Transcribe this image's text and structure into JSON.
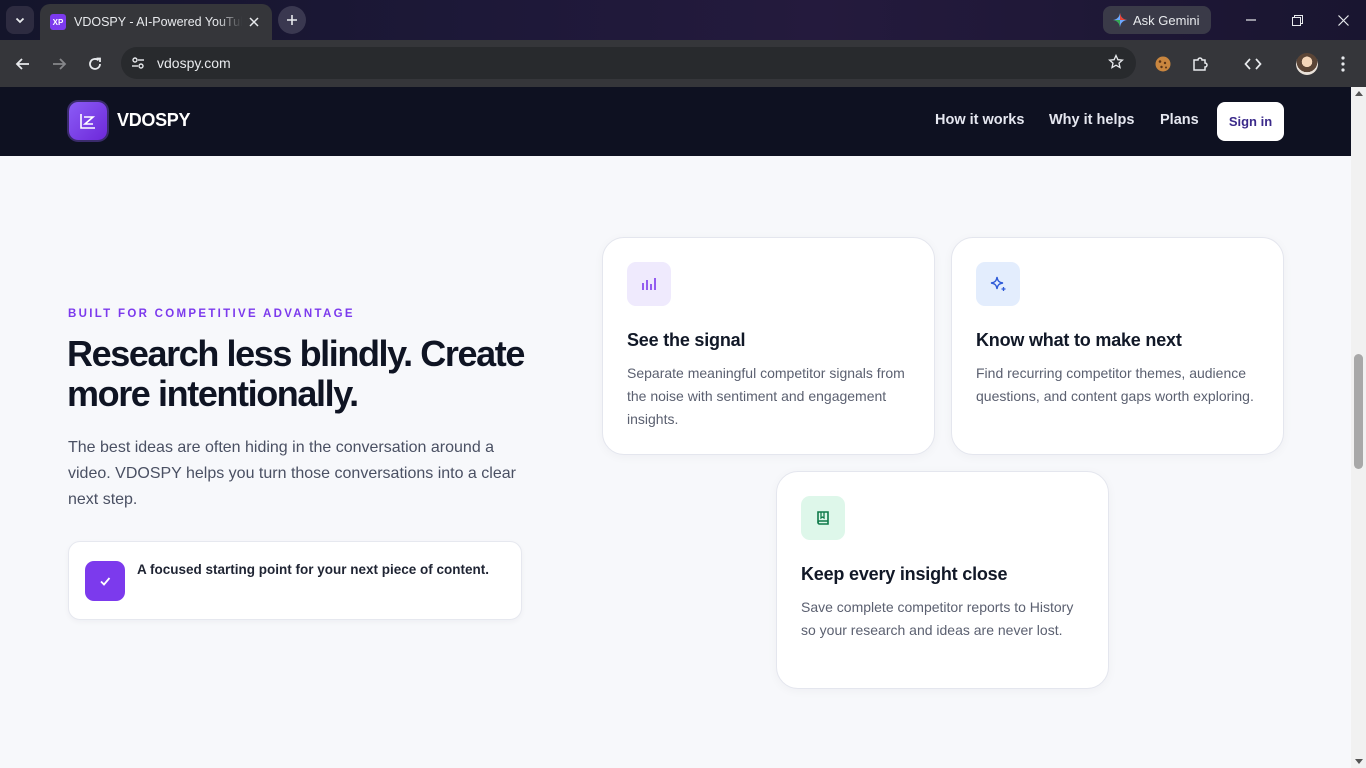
{
  "browser": {
    "tab": {
      "favicon_text": "XP",
      "title": "VDOSPY - AI-Powered YouTube Competitor Research"
    },
    "url": "vdospy.com",
    "gemini_label": "Ask Gemini"
  },
  "nav": {
    "brand": "VDOSPY",
    "links": [
      "How it works",
      "Why it helps",
      "Plans"
    ],
    "signin": "Sign in"
  },
  "hero": {
    "eyebrow": "BUILT FOR COMPETITIVE ADVANTAGE",
    "headline": "Research less blindly. Create more intentionally.",
    "lead": "The best ideas are often hiding in the conversation around a video. VDOSPY helps you turn those conversations into a clear next step.",
    "callout": "A focused starting point for your next piece of content."
  },
  "cards": [
    {
      "icon": "bar-chart-icon",
      "icon_bg": "#efeafd",
      "icon_color": "#7c3aed",
      "title": "See the signal",
      "body": "Separate meaningful competitor signals from the noise with sentiment and engagement insights."
    },
    {
      "icon": "sparkle-icon",
      "icon_bg": "#e3edfd",
      "icon_color": "#2f5bd8",
      "title": "Know what to make next",
      "body": "Find recurring competitor themes, audience questions, and content gaps worth exploring."
    },
    {
      "icon": "book-icon",
      "icon_bg": "#def7ea",
      "icon_color": "#0f7a4a",
      "title": "Keep every insight close",
      "body": "Save complete competitor reports to History so your research and ideas are never lost."
    }
  ],
  "colors": {
    "accent": "#7c3aed",
    "nav_bg": "#0e1121",
    "page_bg": "#f7f8fb"
  }
}
